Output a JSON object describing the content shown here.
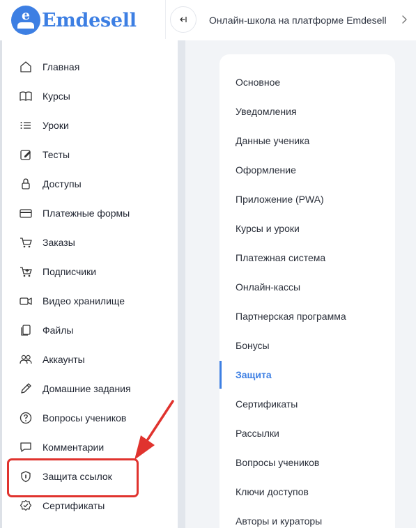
{
  "header": {
    "logo_text": "Emdesell",
    "logo_letter": "e",
    "school_title": "Онлайн-школа на платформе Emdesell"
  },
  "sidebar": {
    "items": [
      {
        "label": "Главная",
        "icon": "home-icon"
      },
      {
        "label": "Курсы",
        "icon": "book-icon"
      },
      {
        "label": "Уроки",
        "icon": "list-icon"
      },
      {
        "label": "Тесты",
        "icon": "edit-icon"
      },
      {
        "label": "Доступы",
        "icon": "lock-icon"
      },
      {
        "label": "Платежные формы",
        "icon": "credit-card-icon"
      },
      {
        "label": "Заказы",
        "icon": "cart-icon"
      },
      {
        "label": "Подписчики",
        "icon": "cart-plus-icon"
      },
      {
        "label": "Видео хранилище",
        "icon": "video-icon"
      },
      {
        "label": "Файлы",
        "icon": "files-icon"
      },
      {
        "label": "Аккаунты",
        "icon": "users-icon"
      },
      {
        "label": "Домашние задания",
        "icon": "pencil-icon"
      },
      {
        "label": "Вопросы учеников",
        "icon": "question-circle-icon"
      },
      {
        "label": "Комментарии",
        "icon": "comment-icon"
      },
      {
        "label": "Защита ссылок",
        "icon": "shield-icon"
      },
      {
        "label": "Сертификаты",
        "icon": "badge-check-icon"
      }
    ]
  },
  "settings": {
    "active_index": 10,
    "items": [
      {
        "label": "Основное"
      },
      {
        "label": "Уведомления"
      },
      {
        "label": "Данные ученика"
      },
      {
        "label": "Оформление"
      },
      {
        "label": "Приложение (PWA)"
      },
      {
        "label": "Курсы и уроки"
      },
      {
        "label": "Платежная система"
      },
      {
        "label": "Онлайн-кассы"
      },
      {
        "label": "Партнерская программа"
      },
      {
        "label": "Бонусы"
      },
      {
        "label": "Защита"
      },
      {
        "label": "Сертификаты"
      },
      {
        "label": "Рассылки"
      },
      {
        "label": "Вопросы учеников"
      },
      {
        "label": "Ключи доступов"
      },
      {
        "label": "Авторы и кураторы"
      }
    ]
  },
  "colors": {
    "accent": "#3d7fe3",
    "annotation": "#e0332e"
  }
}
